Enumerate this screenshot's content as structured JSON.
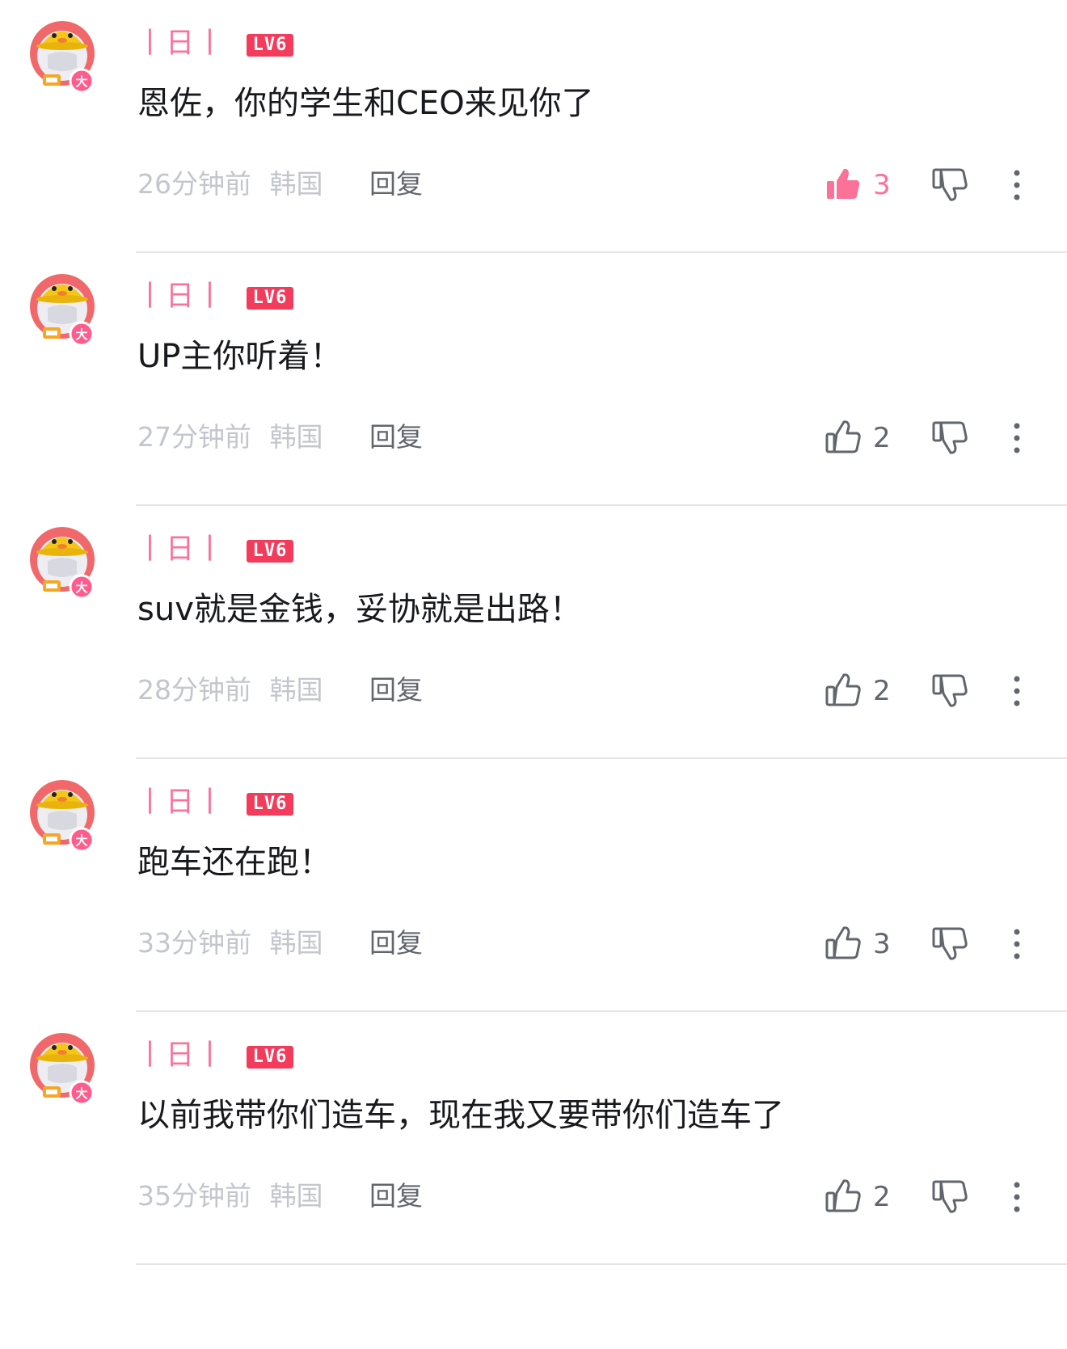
{
  "colors": {
    "accent_pink": "#fb7299",
    "level_red": "#f33c5c",
    "text_primary": "#18191c",
    "text_secondary": "#61666d",
    "text_muted": "#c3c6cc",
    "divider": "#e3e5e7"
  },
  "icons": {
    "like": "thumbs-up-icon",
    "dislike": "thumbs-down-icon",
    "more": "vertical-ellipsis-icon",
    "avatar_badge": "大"
  },
  "comments": [
    {
      "username": "丨日丨",
      "level": "LV6",
      "text": "恩佐，你的学生和CEO来见你了",
      "time": "26分钟前",
      "location": "韩国",
      "reply_label": "回复",
      "likes": "3",
      "liked": true
    },
    {
      "username": "丨日丨",
      "level": "LV6",
      "text": "UP主你听着！",
      "time": "27分钟前",
      "location": "韩国",
      "reply_label": "回复",
      "likes": "2",
      "liked": false
    },
    {
      "username": "丨日丨",
      "level": "LV6",
      "text": "suv就是金钱，妥协就是出路！",
      "time": "28分钟前",
      "location": "韩国",
      "reply_label": "回复",
      "likes": "2",
      "liked": false
    },
    {
      "username": "丨日丨",
      "level": "LV6",
      "text": "跑车还在跑！",
      "time": "33分钟前",
      "location": "韩国",
      "reply_label": "回复",
      "likes": "3",
      "liked": false
    },
    {
      "username": "丨日丨",
      "level": "LV6",
      "text": "以前我带你们造车，现在我又要带你们造车了",
      "time": "35分钟前",
      "location": "韩国",
      "reply_label": "回复",
      "likes": "2",
      "liked": false
    }
  ]
}
